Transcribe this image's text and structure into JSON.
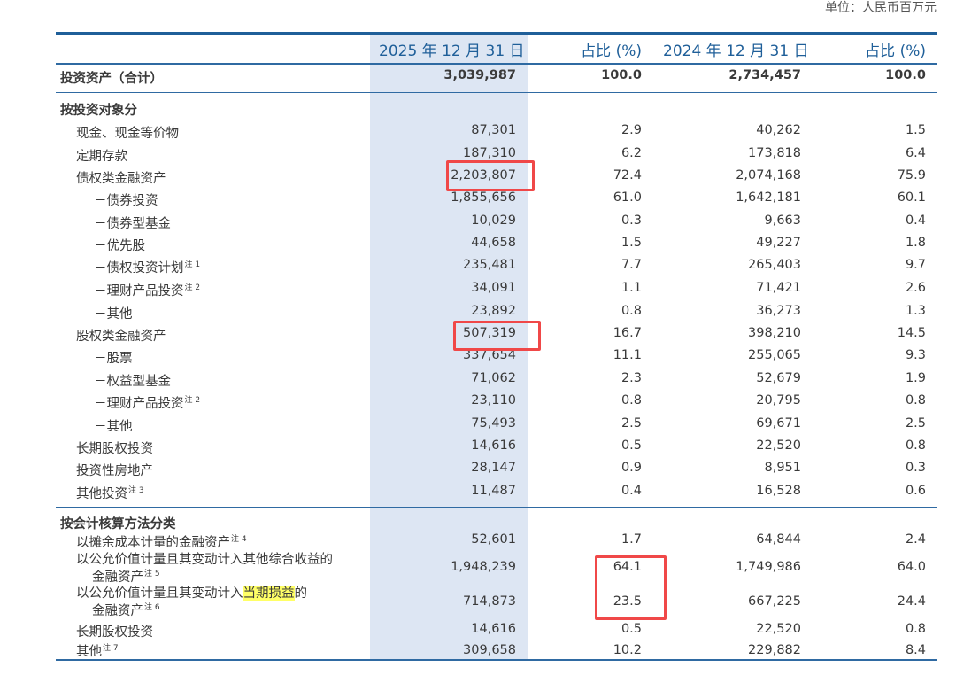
{
  "unit": "单位：人民币百万元",
  "headers": {
    "col1": "2025 年 12 月 31 日",
    "col2": "占比 (%)",
    "col3": "2024 年 12 月 31 日",
    "col4": "占比 (%)"
  },
  "total": {
    "label": "投资资产（合计）",
    "v1": "3,039,987",
    "p1": "100.0",
    "v2": "2,734,457",
    "p2": "100.0"
  },
  "section1": {
    "title": "按投资对象分",
    "rows": [
      {
        "label": "现金、现金等价物",
        "note": "",
        "v1": "87,301",
        "p1": "2.9",
        "v2": "40,262",
        "p2": "1.5"
      },
      {
        "label": "定期存款",
        "note": "",
        "v1": "187,310",
        "p1": "6.2",
        "v2": "173,818",
        "p2": "6.4"
      },
      {
        "label": "债权类金融资产",
        "note": "",
        "v1": "2,203,807",
        "p1": "72.4",
        "v2": "2,074,168",
        "p2": "75.9"
      },
      {
        "label": "－债券投资",
        "note": "",
        "v1": "1,855,656",
        "p1": "61.0",
        "v2": "1,642,181",
        "p2": "60.1"
      },
      {
        "label": "－债券型基金",
        "note": "",
        "v1": "10,029",
        "p1": "0.3",
        "v2": "9,663",
        "p2": "0.4"
      },
      {
        "label": "－优先股",
        "note": "",
        "v1": "44,658",
        "p1": "1.5",
        "v2": "49,227",
        "p2": "1.8"
      },
      {
        "label": "－债权投资计划",
        "note": "注 1",
        "v1": "235,481",
        "p1": "7.7",
        "v2": "265,403",
        "p2": "9.7"
      },
      {
        "label": "－理财产品投资",
        "note": "注 2",
        "v1": "34,091",
        "p1": "1.1",
        "v2": "71,421",
        "p2": "2.6"
      },
      {
        "label": "－其他",
        "note": "",
        "v1": "23,892",
        "p1": "0.8",
        "v2": "36,273",
        "p2": "1.3"
      },
      {
        "label": "股权类金融资产",
        "note": "",
        "v1": "507,319",
        "p1": "16.7",
        "v2": "398,210",
        "p2": "14.5"
      },
      {
        "label": "－股票",
        "note": "",
        "v1": "337,654",
        "p1": "11.1",
        "v2": "255,065",
        "p2": "9.3"
      },
      {
        "label": "－权益型基金",
        "note": "",
        "v1": "71,062",
        "p1": "2.3",
        "v2": "52,679",
        "p2": "1.9"
      },
      {
        "label": "－理财产品投资",
        "note": "注 2",
        "v1": "23,110",
        "p1": "0.8",
        "v2": "20,795",
        "p2": "0.8"
      },
      {
        "label": "－其他",
        "note": "",
        "v1": "75,493",
        "p1": "2.5",
        "v2": "69,671",
        "p2": "2.5"
      },
      {
        "label": "长期股权投资",
        "note": "",
        "v1": "14,616",
        "p1": "0.5",
        "v2": "22,520",
        "p2": "0.8"
      },
      {
        "label": "投资性房地产",
        "note": "",
        "v1": "28,147",
        "p1": "0.9",
        "v2": "8,951",
        "p2": "0.3"
      },
      {
        "label": "其他投资",
        "note": "注 3",
        "v1": "11,487",
        "p1": "0.4",
        "v2": "16,528",
        "p2": "0.6"
      }
    ]
  },
  "section2": {
    "title": "按会计核算方法分类",
    "rows": [
      {
        "label": "以摊余成本计量的金融资产",
        "note": "注 4",
        "v1": "52,601",
        "p1": "1.7",
        "v2": "64,844",
        "p2": "2.4"
      },
      {
        "label_line1": "以公允价值计量且其变动计入其他综合收益的",
        "label_line2": "金融资产",
        "note": "注 5",
        "v1": "1,948,239",
        "p1": "64.1",
        "v2": "1,749,986",
        "p2": "64.0"
      },
      {
        "label_line1a": "以公允价值计量且其变动计入",
        "label_line1_hl": "当期损益",
        "label_line1b": "的",
        "label_line2": "金融资产",
        "note": "注 6",
        "v1": "714,873",
        "p1": "23.5",
        "v2": "667,225",
        "p2": "24.4"
      },
      {
        "label": "长期股权投资",
        "note": "",
        "v1": "14,616",
        "p1": "0.5",
        "v2": "22,520",
        "p2": "0.8"
      },
      {
        "label": "其他",
        "note": "注 7",
        "v1": "309,658",
        "p1": "10.2",
        "v2": "229,882",
        "p2": "8.4"
      }
    ]
  },
  "highlight_color": "#dde6f3",
  "header_color": "#1f5f99",
  "marker_color": "#f04848"
}
